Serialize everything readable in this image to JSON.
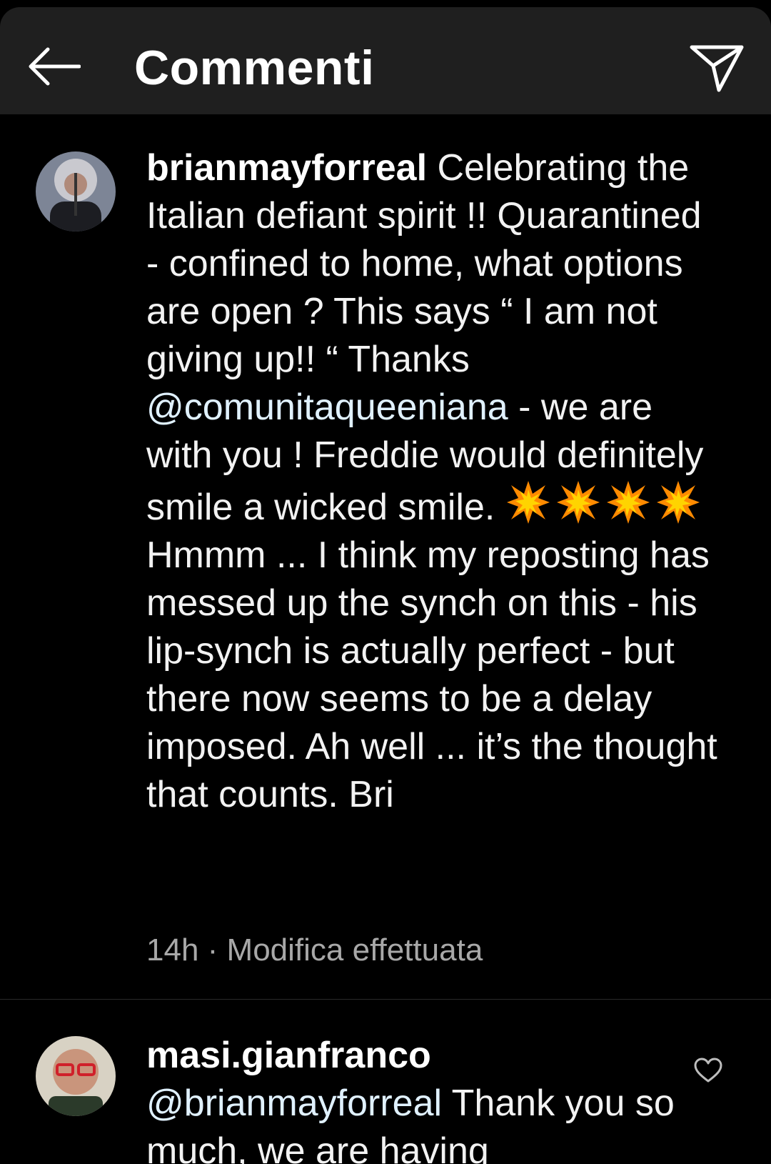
{
  "header": {
    "title": "Commenti",
    "back_icon": "arrow-left-icon",
    "send_icon": "paper-plane-icon"
  },
  "caption": {
    "username": "brianmayforreal",
    "text_part1": "Celebrating the Italian defiant spirit !! Quarantined - confined to home, what options are open ?  This says “ I am not giving up!! “ Thanks ",
    "mention": "@comunitaqueeniana",
    "text_part2": " - we are with you !  Freddie would definitely smile a wicked smile. ",
    "emoji": "💥💥💥💥",
    "text_part3": " Hmmm ... I think my reposting has messed up the synch on this - his lip-synch is actually perfect - but there now seems to be a delay imposed. Ah well ... it’s the thought that counts.  Bri",
    "time": "14h",
    "separator": "·",
    "edited": "Modifica effettuata"
  },
  "comments": [
    {
      "username": "masi.gianfranco",
      "mention": "@brianmayforreal",
      "text_visible": "Thank you so much, we are having"
    }
  ],
  "colors": {
    "header_bg": "#1f1f1f",
    "background": "#000000",
    "mention": "#e0f1ff",
    "meta": "#a8a8a8"
  }
}
